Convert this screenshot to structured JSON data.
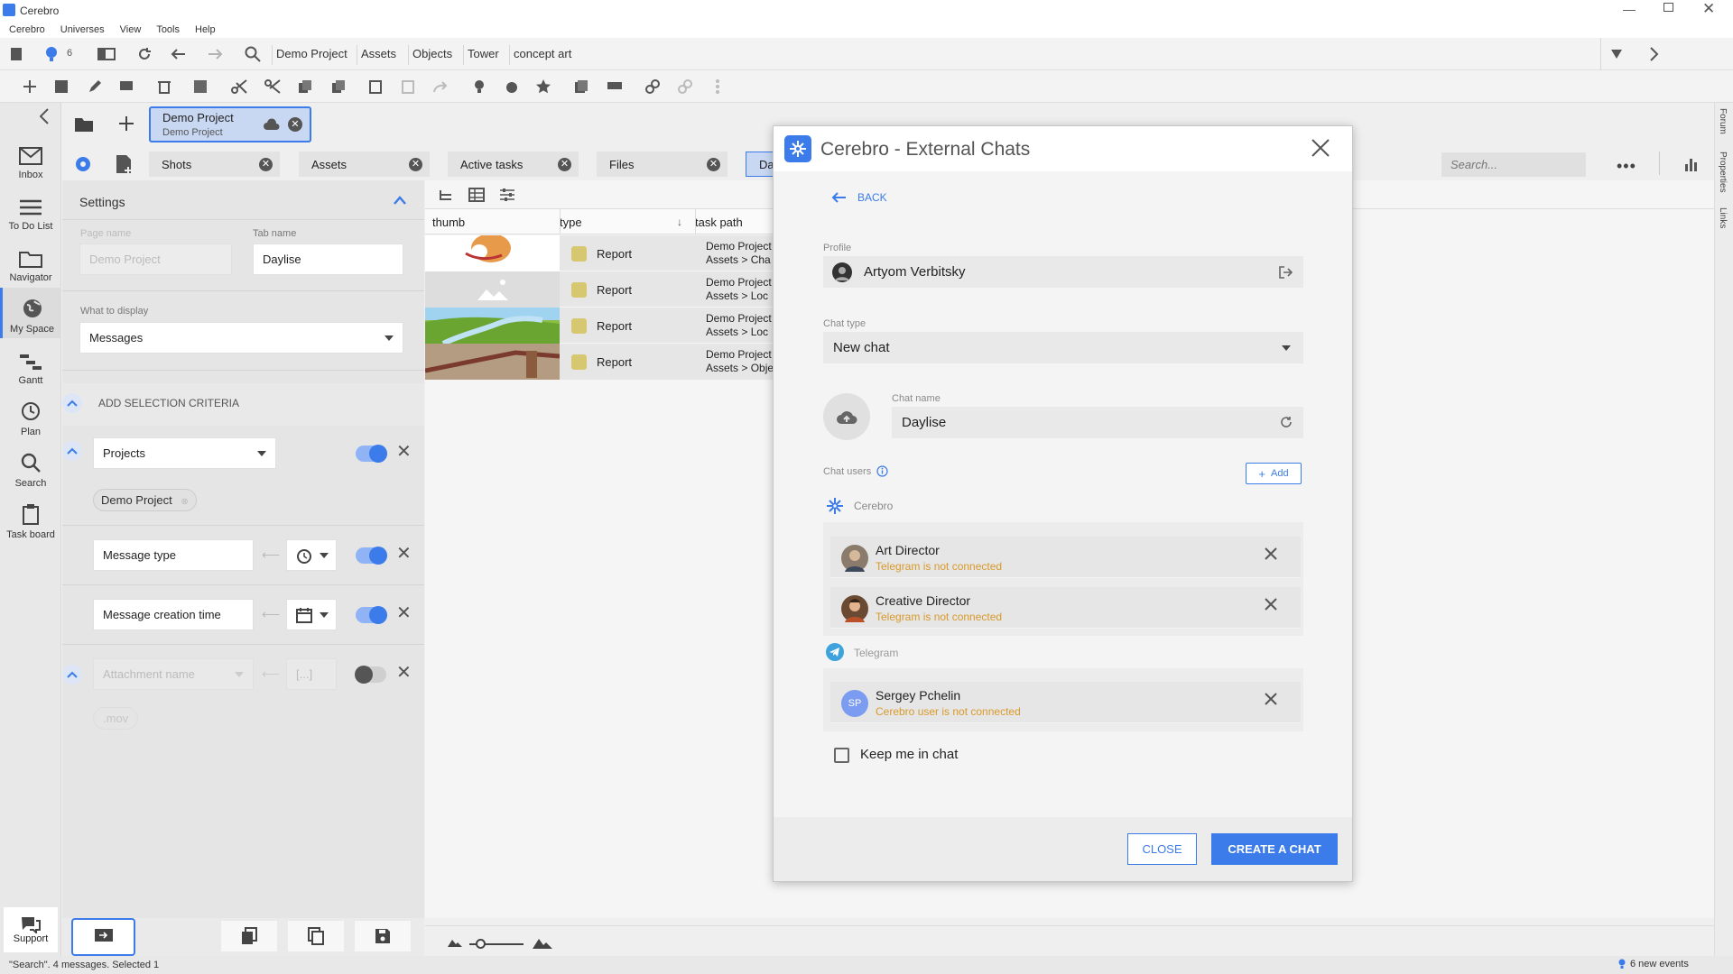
{
  "app": {
    "title": "Cerebro"
  },
  "menu": [
    "Cerebro",
    "Universes",
    "View",
    "Tools",
    "Help"
  ],
  "toolbar": {
    "notif_count": "6",
    "breadcrumbs": [
      "Demo Project",
      "Assets",
      "Objects",
      "Tower",
      "concept art"
    ]
  },
  "project_tab": {
    "title": "Demo Project",
    "subtitle": "Demo Project"
  },
  "tabs": [
    {
      "label": "Shots"
    },
    {
      "label": "Assets"
    },
    {
      "label": "Active tasks"
    },
    {
      "label": "Files"
    },
    {
      "label": "Da"
    }
  ],
  "search": {
    "placeholder": "Search..."
  },
  "sidebar": {
    "items": [
      {
        "label": "Inbox",
        "icon": "mail-icon"
      },
      {
        "label": "To Do List",
        "icon": "list-icon"
      },
      {
        "label": "Navigator",
        "icon": "folder-icon"
      },
      {
        "label": "My Space",
        "icon": "globe-icon"
      },
      {
        "label": "Gantt",
        "icon": "gantt-icon"
      },
      {
        "label": "Plan",
        "icon": "clock-icon"
      },
      {
        "label": "Search",
        "icon": "search-icon"
      },
      {
        "label": "Task board",
        "icon": "clipboard-icon"
      }
    ],
    "support": "Support"
  },
  "settings": {
    "title": "Settings",
    "page_name_label": "Page name",
    "page_name_value": "Demo Project",
    "tab_name_label": "Tab name",
    "tab_name_value": "Daylise",
    "display_label": "What to display",
    "display_value": "Messages",
    "criteria_label": "ADD SELECTION CRITERIA",
    "projects_select": "Projects",
    "project_chip": "Demo Project",
    "message_type": "Message type",
    "message_creation_time": "Message creation time",
    "attachment_name": "Attachment name",
    "attachment_chip": ".mov"
  },
  "grid": {
    "columns": [
      "thumb",
      "type",
      "task path"
    ],
    "rows": [
      {
        "type": "Report",
        "path1": "Demo Project",
        "path2": "Assets > Cha"
      },
      {
        "type": "Report",
        "path1": "Demo Project",
        "path2": "Assets > Loc"
      },
      {
        "type": "Report",
        "path1": "Demo Project",
        "path2": "Assets > Loc"
      },
      {
        "type": "Report",
        "path1": "Demo Project",
        "path2": "Assets > Obje"
      }
    ]
  },
  "right_rail": [
    "Forum",
    "Properties",
    "Links"
  ],
  "modal": {
    "title": "Cerebro - External Chats",
    "back": "BACK",
    "profile_label": "Profile",
    "profile_value": "Artyom Verbitsky",
    "chat_type_label": "Chat type",
    "chat_type_value": "New chat",
    "chat_name_label": "Chat name",
    "chat_name_value": "Daylise",
    "chat_users_label": "Chat users",
    "add_label": "Add",
    "cerebro_group": "Cerebro",
    "telegram_group": "Telegram",
    "cerebro_users": [
      {
        "name": "Art Director",
        "status": "Telegram is not connected"
      },
      {
        "name": "Creative Director",
        "status": "Telegram is not connected"
      }
    ],
    "telegram_users": [
      {
        "initials": "SP",
        "name": "Sergey Pchelin",
        "status": "Cerebro user is not connected"
      }
    ],
    "keep_me": "Keep me in chat",
    "close": "CLOSE",
    "create": "CREATE A CHAT"
  },
  "status": {
    "left": "\"Search\". 4 messages. Selected 1",
    "right": "6 new events"
  },
  "colors": {
    "accent": "#3b7bea",
    "warning": "#d89a2b"
  }
}
